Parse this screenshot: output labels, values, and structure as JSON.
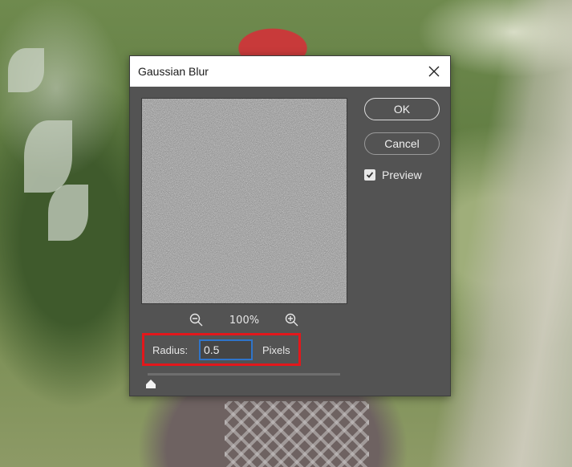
{
  "dialog": {
    "title": "Gaussian Blur",
    "ok_label": "OK",
    "cancel_label": "Cancel",
    "preview_label": "Preview",
    "preview_checked": true,
    "zoom_level": "100%",
    "radius_label": "Radius:",
    "radius_value": "0.5",
    "radius_unit": "Pixels",
    "slider_value": 0.5
  },
  "colors": {
    "dialog_bg": "#535353",
    "highlight": "#e3171b",
    "input_focus": "#2f74c9"
  },
  "icons": {
    "close": "close-icon",
    "zoom_out": "zoom-out-icon",
    "zoom_in": "zoom-in-icon",
    "checkbox": "checkmark-icon",
    "slider": "slider-thumb-icon"
  }
}
